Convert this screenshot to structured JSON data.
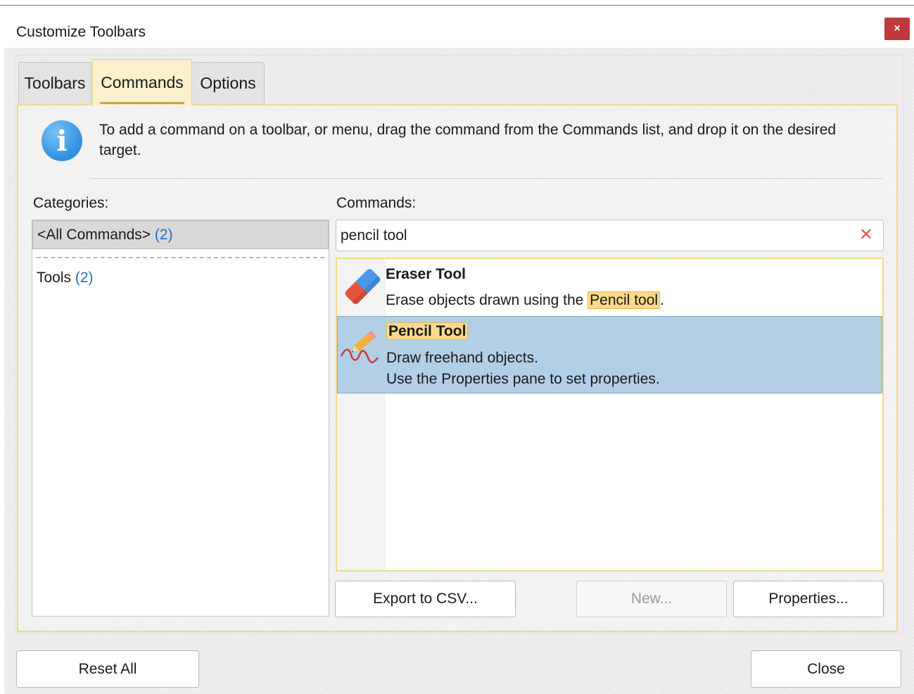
{
  "window": {
    "title": "Customize Toolbars",
    "close_glyph": "×"
  },
  "tabs": [
    {
      "label": "Toolbars",
      "active": false
    },
    {
      "label": "Commands",
      "active": true
    },
    {
      "label": "Options",
      "active": false
    }
  ],
  "info": {
    "icon": "info-icon",
    "glyph": "i",
    "text": "To add a command on a toolbar, or menu, drag the command from the Commands list, and drop it on the desired target."
  },
  "categories": {
    "label": "Categories:",
    "items": [
      {
        "name": "<All Commands>",
        "count": "(2)",
        "selected": true
      },
      {
        "name": "Tools",
        "count": "(2)",
        "selected": false
      }
    ]
  },
  "commands": {
    "label": "Commands:",
    "search_value": "pencil tool",
    "clear_glyph": "✕",
    "items": [
      {
        "title": "Eraser Tool",
        "desc_before": "Erase objects drawn using the ",
        "desc_highlight": "Pencil tool",
        "desc_after": ".",
        "icon": "eraser-icon",
        "selected": false
      },
      {
        "title": "Pencil Tool",
        "desc_line1": "Draw freehand objects.",
        "desc_line2": "Use the Properties pane to set properties.",
        "icon": "pencil-icon",
        "selected": true
      }
    ]
  },
  "buttons": {
    "export": "Export to CSV...",
    "new": "New...",
    "properties": "Properties...",
    "reset_all": "Reset All",
    "close": "Close"
  },
  "colors": {
    "accent": "#f2d98a",
    "selection": "#b2cfe6",
    "highlight": "#fcd98a",
    "close_red": "#c0393b",
    "count_blue": "#1e6fc2"
  }
}
